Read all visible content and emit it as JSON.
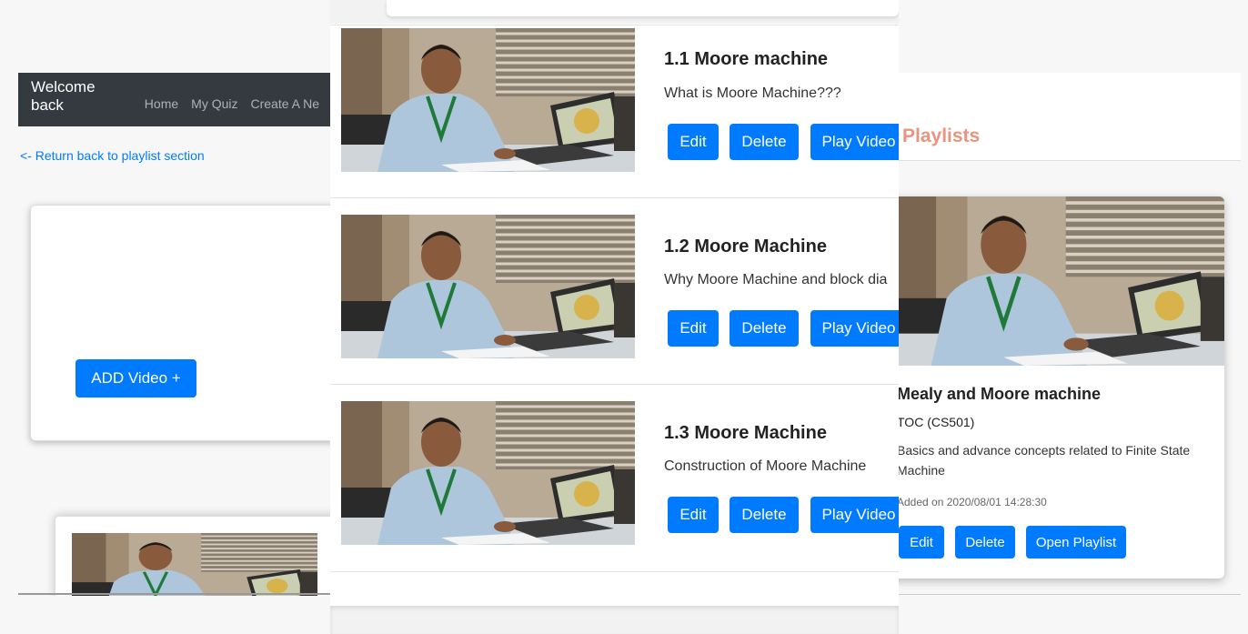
{
  "navbar": {
    "brand": "Welcome back",
    "links": [
      "Home",
      "My Quiz",
      "Create A Ne"
    ]
  },
  "left": {
    "return_link": "<- Return back to playlist section",
    "add_video_button": "ADD Video +"
  },
  "videos": [
    {
      "title": "1.1 Moore machine",
      "description": "What is Moore Machine???",
      "edit": "Edit",
      "delete": "Delete",
      "play": "Play Video"
    },
    {
      "title": "1.2 Moore Machine",
      "description": "Why Moore Machine and block dia",
      "edit": "Edit",
      "delete": "Delete",
      "play": "Play Video"
    },
    {
      "title": "1.3 Moore Machine",
      "description": "Construction of Moore Machine",
      "edit": "Edit",
      "delete": "Delete",
      "play": "Play Video"
    }
  ],
  "playlists": {
    "heading": "Playlists",
    "card": {
      "title": "Mealy and Moore machine",
      "code": "TOC (CS501)",
      "description": "Basics and advance concepts related to Finite State Machine",
      "added_on": "Added on 2020/08/01 14:28:30",
      "edit": "Edit",
      "delete": "Delete",
      "open": "Open Playlist"
    }
  },
  "colors": {
    "primary": "#007bff",
    "navbar": "#343a40",
    "playlists_heading": "#e8947e"
  },
  "icons": {
    "thumbnail": "instructor-photo-thumbnail"
  }
}
